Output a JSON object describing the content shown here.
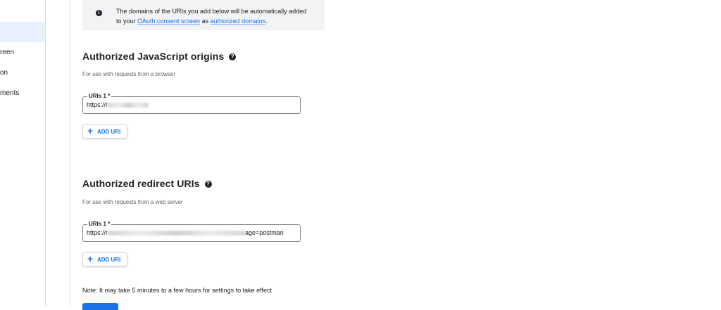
{
  "sidebar": {
    "items": [
      {
        "label": "reen"
      },
      {
        "label": "on"
      },
      {
        "label": "ments"
      }
    ]
  },
  "info": {
    "line1": "The domains of the URIs you add below will be automatically added",
    "prefix": "to your ",
    "link1": "OAuth consent screen",
    "middle": " as ",
    "link2": "authorized domains",
    "suffix": "."
  },
  "js_origins": {
    "title": "Authorized JavaScript origins",
    "subtitle": "For use with requests from a browser",
    "field_label": "URIs 1 *",
    "value_prefix": "https://r",
    "add_label": "ADD URI"
  },
  "redirect": {
    "title": "Authorized redirect URIs",
    "subtitle": "For use with requests from a web server",
    "field_label": "URIs 1 *",
    "value_prefix": "https://r",
    "value_suffix": "age=postman",
    "add_label": "ADD URI"
  },
  "note": "Note: It may take 5 minutes to a few hours for settings to take effect",
  "colors": {
    "accent": "#1a73e8",
    "sidebar_selected": "#e8f0fe",
    "info_background": "#f1f3f4"
  }
}
